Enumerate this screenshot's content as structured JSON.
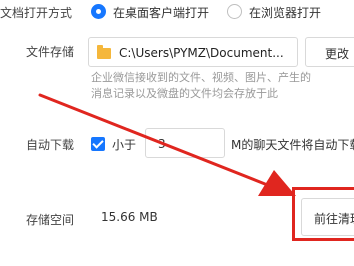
{
  "doc_open": {
    "label": "文档打开方式",
    "option_client": "在桌面客户端打开",
    "option_browser": "在浏览器打开"
  },
  "file_storage": {
    "label": "文件存储",
    "path": "C:\\Users\\PYMZ\\Document...",
    "change_label": "更改",
    "hint_line1": "企业微信接收到的文件、视频、图片、产生的",
    "hint_line2": "消息记录以及微盘的文件均会存放于此"
  },
  "auto_download": {
    "label": "自动下载",
    "prefix": "小于",
    "value": "3",
    "suffix": "M的聊天文件将自动下载"
  },
  "storage_space": {
    "label": "存储空间",
    "size": "15.66 MB",
    "clean_label": "前往清理"
  },
  "colors": {
    "accent": "#1677ff",
    "annotation_red": "#e0261f",
    "folder": "#f5b73b"
  },
  "icons": [
    "radio-checked-icon",
    "radio-unchecked-icon",
    "folder-icon",
    "checkbox-checked-icon",
    "annotation-arrow-icon"
  ]
}
